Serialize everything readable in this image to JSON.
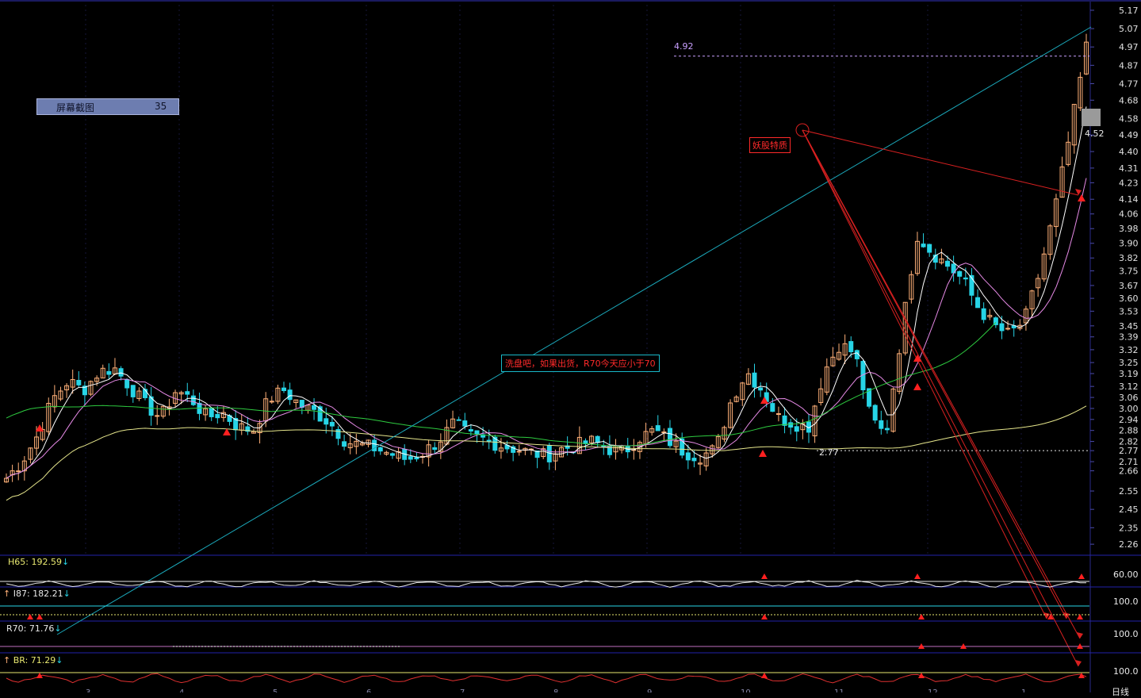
{
  "overlay": {
    "screenshot_label": "屏幕截图",
    "screenshot_count": "35",
    "note_wash": "洗盘吧，如果出货，R70今天应小于70",
    "note_demon": "妖股特质",
    "level_high": "4.92",
    "level_low": "2.77",
    "current_price": "4.52",
    "period_label": "日线"
  },
  "indicators": [
    {
      "label": "H65: 192.59",
      "arrow": "↓",
      "ref": "60.00",
      "color": "#e8e870"
    },
    {
      "label": "I87: 182.21",
      "arrow": "↓",
      "ref": "100.0",
      "color": "#e8e8e8"
    },
    {
      "label": "R70: 71.76",
      "arrow": "↓",
      "ref": "100.0",
      "color": "#e8e8e8"
    },
    {
      "label": "BR: 71.29",
      "arrow": "↓",
      "ref": "100.0",
      "color": "#e8e870"
    }
  ],
  "months": [
    "3",
    "4",
    "5",
    "6",
    "7",
    "8",
    "9",
    "10",
    "11",
    "12",
    "1"
  ],
  "colors": {
    "up": "#ffb078",
    "down": "#27d4e6",
    "ma5": "#ffffff",
    "ma10": "#e68ae6",
    "ma60": "#2ecc40",
    "ma120": "#e6e68c",
    "trend": "#1ba9bb",
    "arrow": "#d82020"
  },
  "chart_data": {
    "type": "candlestick",
    "title": "",
    "y_ticks": [
      "5.17",
      "5.07",
      "4.97",
      "4.87",
      "4.77",
      "4.68",
      "4.58",
      "4.49",
      "4.40",
      "4.31",
      "4.23",
      "4.14",
      "4.06",
      "3.98",
      "3.90",
      "3.82",
      "3.75",
      "3.67",
      "3.60",
      "3.53",
      "3.45",
      "3.39",
      "3.32",
      "3.25",
      "3.19",
      "3.12",
      "3.06",
      "3.00",
      "2.94",
      "2.88",
      "2.82",
      "2.77",
      "2.71",
      "2.66",
      "2.55",
      "2.45",
      "2.35",
      "2.26"
    ],
    "ylim": [
      2.2,
      5.2
    ],
    "x": [
      "3",
      "4",
      "5",
      "6",
      "7",
      "8",
      "9",
      "10",
      "11",
      "12",
      "1"
    ],
    "series": [
      {
        "name": "price",
        "values": [
          2.62,
          2.71,
          2.85,
          3.05,
          3.15,
          3.1,
          3.2,
          3.22,
          3.12,
          3.02,
          2.95,
          3.1,
          3.05,
          2.95,
          2.98,
          2.9,
          2.88,
          3.05,
          3.1,
          3.02,
          2.98,
          2.92,
          2.82,
          2.8,
          2.78,
          2.75,
          2.72,
          2.76,
          2.82,
          2.92,
          2.85,
          2.83,
          2.8,
          2.78,
          2.76,
          2.74,
          2.78,
          2.8,
          2.82,
          2.78,
          2.76,
          2.84,
          2.88,
          2.82,
          2.76,
          2.74,
          2.78,
          3.05,
          3.2,
          3.1,
          2.95,
          2.92,
          2.9,
          3.2,
          3.35,
          3.3,
          2.95,
          2.85,
          3.4,
          3.95,
          3.85,
          3.78,
          3.7,
          3.55,
          3.45,
          3.4,
          3.48,
          3.75,
          4.1,
          4.52,
          4.97
        ]
      }
    ],
    "levels": [
      4.92,
      2.77
    ]
  }
}
